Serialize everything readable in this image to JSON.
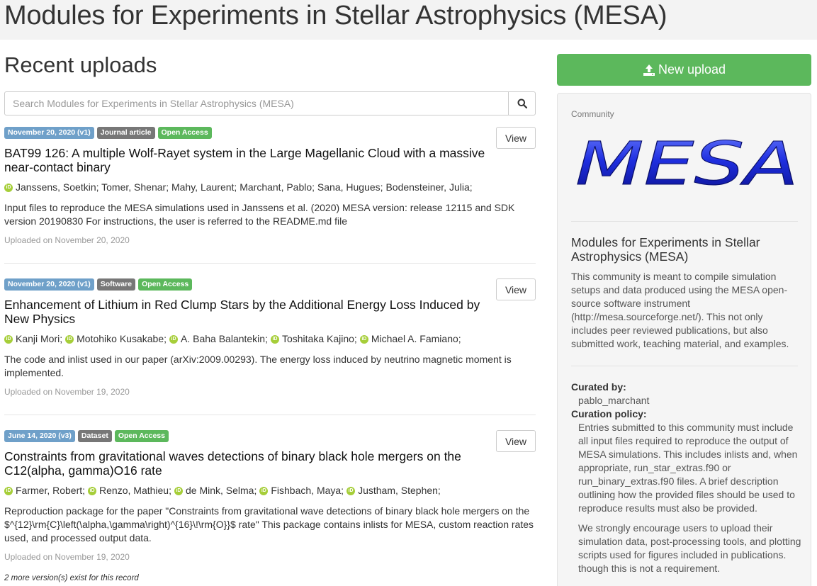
{
  "header": {
    "title": "Modules for Experiments in Stellar Astrophysics (MESA)"
  },
  "main": {
    "section_title": "Recent uploads",
    "search": {
      "placeholder": "Search Modules for Experiments in Stellar Astrophysics (MESA)",
      "icon": "search-icon"
    },
    "view_label": "View",
    "records": [
      {
        "date_badge": "November 20, 2020 (v1)",
        "type_badge": "Journal article",
        "access_badge": "Open Access",
        "title": "BAT99 126: A multiple Wolf-Rayet system in the Large Magellanic Cloud with a massive near-contact binary",
        "authors_text": "Janssens, Soetkin; Tomer, Shenar; Mahy, Laurent; Marchant, Pablo; Sana, Hugues; Bodensteiner, Julia;",
        "description": "Input files to reproduce the MESA simulations used in Janssens et al. (2020) MESA version: release 12115 and SDK version 20190830 For instructions, the user is referred to the README.md file",
        "uploaded": "Uploaded on November 20, 2020"
      },
      {
        "date_badge": "November 20, 2020 (v1)",
        "type_badge": "Software",
        "access_badge": "Open Access",
        "title": "Enhancement of Lithium in Red Clump Stars by the Additional Energy Loss Induced by New Physics",
        "authors": [
          "Kanji Mori;",
          "Motohiko Kusakabe;",
          "A. Baha Balantekin;",
          "Toshitaka Kajino;",
          "Michael A. Famiano;"
        ],
        "description": "The code and inlist used in our paper (arXiv:2009.00293). The energy loss induced by neutrino magnetic moment is implemented.",
        "uploaded": "Uploaded on November 19, 2020"
      },
      {
        "date_badge": "June 14, 2020 (v3)",
        "type_badge": "Dataset",
        "access_badge": "Open Access",
        "title": "Constraints from gravitational waves detections of binary black hole mergers on the C12(alpha, gamma)O16 rate",
        "authors": [
          "Farmer, Robert;",
          "Renzo, Mathieu;",
          "de Mink, Selma;",
          "Fishbach, Maya;",
          "Justham, Stephen;"
        ],
        "description": "Reproduction package for the paper \"Constraints from gravitational wave detections of binary black hole mergers on the $^{12}\\rm{C}\\left(\\alpha,\\gamma\\right)^{16}\\!\\rm{O}}$ rate\"   This package contains inlists for MESA, custom reaction rates used, and processed output data.",
        "uploaded": "Uploaded on November 19, 2020",
        "versions_note": "2 more version(s) exist for this record"
      }
    ]
  },
  "sidebar": {
    "new_upload_label": "New upload",
    "community_label": "Community",
    "logo_text": "MESA",
    "community_title": "Modules for Experiments in Stellar Astrophysics (MESA)",
    "community_description": "This community is meant to compile simulation setups and data produced using the MESA open-source software instrument (http://mesa.sourceforge.net/). This not only includes peer reviewed publications, but also submitted work, teaching material, and examples.",
    "curated_by_label": "Curated by:",
    "curated_by": "pablo_marchant",
    "policy_label": "Curation policy:",
    "policy_p1": "Entries submitted to this community must include all input files required to reproduce the output of MESA simulations. This includes inlists and, when appropriate, run_star_extras.f90 or run_binary_extras.f90 files. A brief description outlining how the provided files should be used to reproduce results must also be provided.",
    "policy_p2": "We strongly encourage users to upload their simulation data, post-processing tools, and plotting scripts used for figures included in publications. though this is not a requirement."
  },
  "colors": {
    "accent_green": "#5cb85c",
    "date_badge": "#6fa0c9",
    "type_badge": "#777777",
    "orcid": "#a6ce39"
  }
}
